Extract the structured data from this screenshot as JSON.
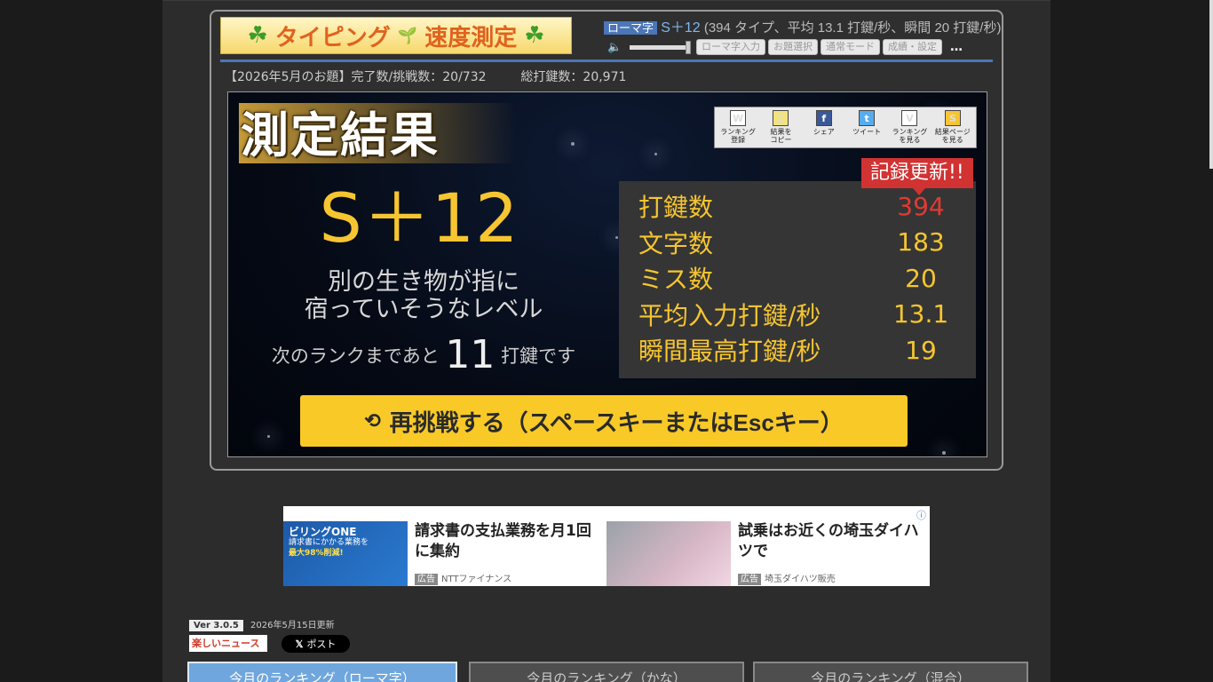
{
  "header": {
    "logo_text_left": "タイピング",
    "logo_text_right": "速度測定",
    "mode_tag": "ローマ字",
    "top_rank": "S＋12",
    "top_summary": "(394 タイプ、平均 13.1 打鍵/秒、瞬間 20 打鍵/秒)",
    "buttons": [
      "ローマ字入力",
      "お題選択",
      "通常モード",
      "成績・設定"
    ],
    "more": "…"
  },
  "stats_line": {
    "challenge": "【2026年5月のお題】完了数/挑戦数：20/732",
    "total": "総打鍵数：20,971"
  },
  "result": {
    "title": "測定結果",
    "share": [
      {
        "icon": "W",
        "label": "ランキング\n登録",
        "color": "#ffffff"
      },
      {
        "icon": "≣",
        "label": "結果を\nコピー",
        "color": "#f3e37a"
      },
      {
        "icon": "f",
        "label": "シェア",
        "color": "#3b5998"
      },
      {
        "icon": "t",
        "label": "ツイート",
        "color": "#55acee"
      },
      {
        "icon": "V",
        "label": "ランキング\nを見る",
        "color": "#ffffff"
      },
      {
        "icon": "S",
        "label": "結果ページ\nを見る",
        "color": "#f7c531"
      }
    ],
    "rank": "S＋12",
    "comment_line1": "別の生き物が指に",
    "comment_line2": "宿っていそうなレベル",
    "next_prefix": "次のランクまであと",
    "next_value": "11",
    "next_suffix": "打鍵です",
    "record": "記録更新!!",
    "stats": [
      {
        "label": "打鍵数",
        "value": "394"
      },
      {
        "label": "文字数",
        "value": "183"
      },
      {
        "label": "ミス数",
        "value": "20"
      },
      {
        "label": "平均入力打鍵/秒",
        "value": "13.1"
      },
      {
        "label": "瞬間最高打鍵/秒",
        "value": "19"
      }
    ],
    "retry": "再挑戦する（スペースキーまたはEscキー）"
  },
  "ad": {
    "unit1_title": "請求書の支払業務を月1回に集約",
    "unit1_tag": "広告",
    "unit1_sponsor": "NTTファイナンス",
    "unit1_image_text": "ビリングONE",
    "unit1_image_sub": "請求書にかかる業務を",
    "unit1_image_hl": "最大98%削減!",
    "unit2_title": "試乗はお近くの埼玉ダイハツで",
    "unit2_tag": "広告",
    "unit2_sponsor": "埼玉ダイハツ販売",
    "info": "ⓘ"
  },
  "footer": {
    "version": "Ver 3.0.5",
    "updated": "2026年5月15日更新",
    "news": "楽しいニュース",
    "xpost": "ポスト",
    "tabs": [
      "今月のランキング（ローマ字）",
      "今月のランキング（かな）",
      "今月のランキング（混合）"
    ]
  }
}
